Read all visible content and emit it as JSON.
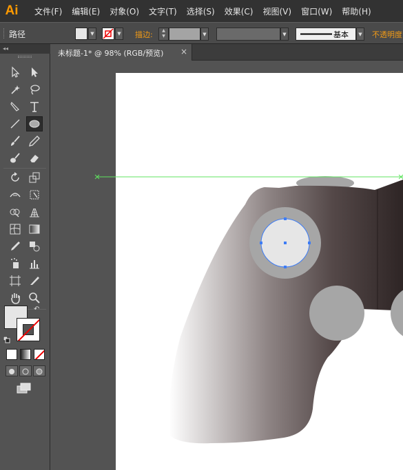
{
  "app": {
    "logo": "Ai"
  },
  "menu": [
    "文件(F)",
    "编辑(E)",
    "对象(O)",
    "文字(T)",
    "选择(S)",
    "效果(C)",
    "视图(V)",
    "窗口(W)",
    "帮助(H)"
  ],
  "control_bar": {
    "selection_label": "路径",
    "fill_color": "#e6e6e6",
    "stroke_label": "描边:",
    "stroke_profile_label": "基本",
    "opacity_label": "不透明度"
  },
  "tools_panel": {
    "collapse_glyph": "◂◂",
    "tools": [
      "selection-tool",
      "direct-selection-tool",
      "magic-wand-tool",
      "lasso-tool",
      "pen-tool",
      "type-tool",
      "line-segment-tool",
      "ellipse-tool",
      "paintbrush-tool",
      "pencil-tool",
      "blob-brush-tool",
      "eraser-tool",
      "rotate-tool",
      "scale-tool",
      "width-tool",
      "free-transform-tool",
      "shape-builder-tool",
      "perspective-grid-tool",
      "mesh-tool",
      "gradient-tool",
      "eyedropper-tool",
      "blend-tool",
      "symbol-sprayer-tool",
      "column-graph-tool",
      "artboard-tool",
      "slice-tool",
      "hand-tool",
      "zoom-tool"
    ],
    "active_tool": "ellipse-tool",
    "fill_color": "#e6e6e6",
    "stroke": "none"
  },
  "document": {
    "tab_title": "未标题-1* @ 98% (RGB/预览)",
    "close_glyph": "×"
  },
  "artwork": {
    "body_gradient_light": "#ffffff",
    "body_gradient_dark": "#2e2525",
    "thumb_ring_color": "#a6a6a6",
    "thumb_stick_color": "#e6e6e6",
    "button_color": "#a6a6a6",
    "selection_color": "#3d7cf5",
    "guide_color": "#5fe35f"
  }
}
